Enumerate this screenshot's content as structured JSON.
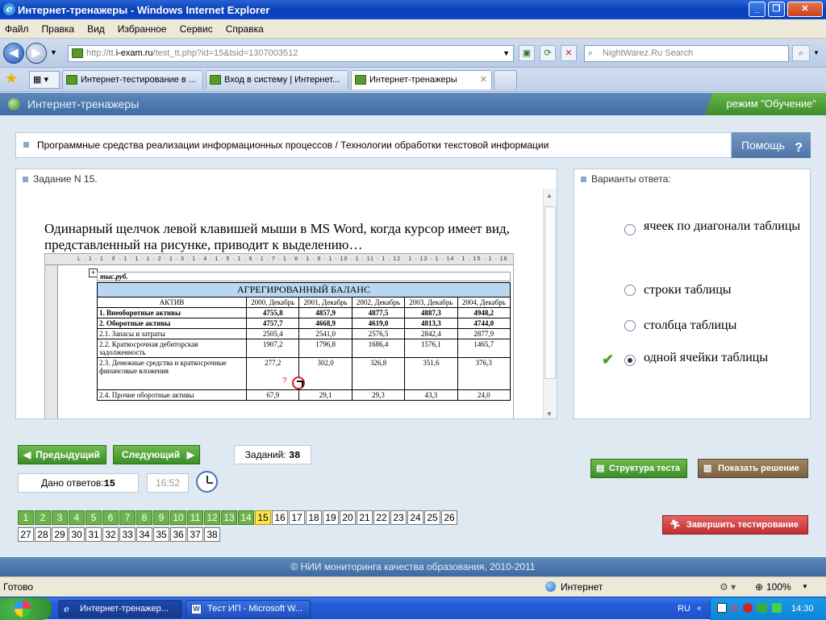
{
  "window": {
    "title": "Интернет-тренажеры - Windows Internet Explorer"
  },
  "menu": [
    "Файл",
    "Правка",
    "Вид",
    "Избранное",
    "Сервис",
    "Справка"
  ],
  "address": {
    "url_prefix": "http://tt.",
    "url_domain": "i-exam.ru",
    "url_rest": "/test_tt.php?id=15&tsid=1307003512"
  },
  "search": {
    "placeholder": "NightWarez.Ru Search"
  },
  "tabs": [
    {
      "label": "Интернет-тестирование в ..."
    },
    {
      "label": "Вход в систему | Интернет..."
    },
    {
      "label": "Интернет-тренажеры"
    }
  ],
  "header": {
    "title": "Интернет-тренажеры",
    "mode": "режим \"Обучение\""
  },
  "breadcrumb": "Программные средства реализации информационных процессов / Технологии обработки текстовой информации",
  "help_label": "Помощь",
  "task": {
    "header": "Задание N 15.",
    "question": "Одинарный щелчок левой клавишей мыши в MS Word, когда курсор имеет вид, представленный на рисунке, приводит к выделению…"
  },
  "word_image": {
    "ruler": "L · 1 · 1 · ⊼ · 1 · 1 · 1 · 2 · 1 · 3 · 1 · 4 · 1 · 5 · 1 · 6 · 1 · 7 · 1 · 8 · 1 · 9 · 1 · 10 · 1 · 11 · 1 · 12 · 1 · 13 · 1 · 14 · 1 · 15 · 1 · 16",
    "caption": "тыс.руб.",
    "table_title": "АГРЕГИРОВАННЫЙ БАЛАНС",
    "col_aktiv": "АКТИВ",
    "years": [
      "2000, Декабрь",
      "2001, Декабрь",
      "2002, Декабрь",
      "2003, Декабрь",
      "2004, Декабрь"
    ],
    "rows": [
      {
        "label": "1. Внеоборотные активы",
        "values": [
          "4755,8",
          "4857,9",
          "4877,5",
          "4887,3",
          "4948,2"
        ],
        "bold": true
      },
      {
        "label": "2. Оборотные активы",
        "values": [
          "4757,7",
          "4668,9",
          "4619,0",
          "4813,3",
          "4744,0"
        ],
        "bold": true
      },
      {
        "label": "2.1. Запасы и затраты",
        "values": [
          "2505,4",
          "2541,0",
          "2576,5",
          "2842,4",
          "2877,9"
        ],
        "bold": false
      },
      {
        "label": "2.2. Краткосрочная дебиторская задолженность",
        "values": [
          "1907,2",
          "1796,8",
          "1686,4",
          "1576,1",
          "1465,7"
        ],
        "bold": false
      },
      {
        "label": "2.3. Денежные средства и краткосрочные финансовые вложения",
        "values": [
          "277,2",
          "302,0",
          "326,8",
          "351,6",
          "376,3"
        ],
        "bold": false
      },
      {
        "label": "2.4. Прочие оборотные активы",
        "values": [
          "67,9",
          "29,1",
          "29,3",
          "43,3",
          "24,0"
        ],
        "bold": false
      }
    ]
  },
  "answers": {
    "header": "Варианты ответа:",
    "options": [
      {
        "label": "ячеек по диагонали таблицы",
        "selected": false
      },
      {
        "label": "строки таблицы",
        "selected": false
      },
      {
        "label": "столбца таблицы",
        "selected": false
      },
      {
        "label": "одной ячейки таблицы",
        "selected": true
      }
    ]
  },
  "controls": {
    "prev": "Предыдущий",
    "next": "Следующий",
    "tasks_label": "Заданий:",
    "tasks_count": "38",
    "answers_label": "Дано ответов:",
    "answers_count": "15",
    "time": "16:52",
    "structure": "Структура теста",
    "show_solution": "Показать решение",
    "finish": "Завершить тестирование"
  },
  "navigator": {
    "current": 15,
    "answered_upto": 14,
    "total": 38
  },
  "footer": "© НИИ мониторинга качества образования, 2010-2011",
  "status": {
    "left": "Готово",
    "zone": "Интернет",
    "zoom": "100%"
  },
  "taskbar": {
    "items": [
      "Интернет-тренажер...",
      "Тест ИП - Microsoft W..."
    ],
    "lang": "RU",
    "time": "14:30"
  },
  "colors": {
    "accent": "#4f75a8",
    "green": "#4c9a22",
    "current": "#ffe34a",
    "finish": "#d13c3c"
  }
}
